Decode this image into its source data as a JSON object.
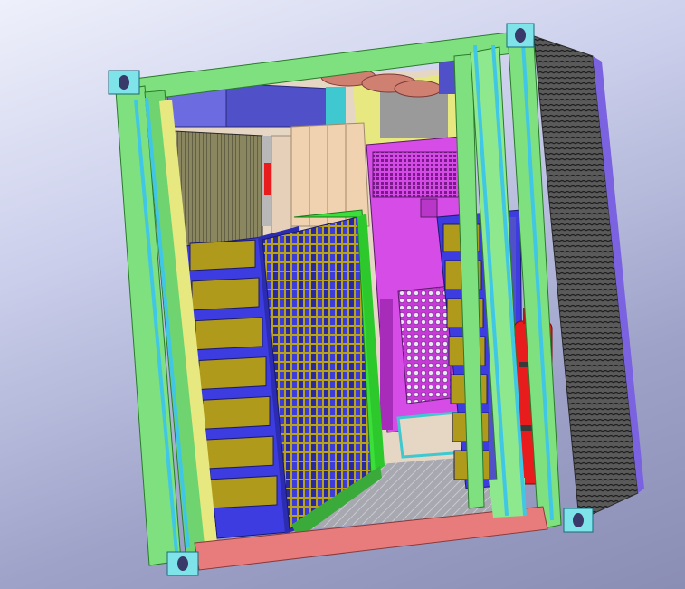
{
  "viewport": {
    "background": "gradient-blue-grey"
  },
  "model": {
    "view": "isometric-open-side",
    "colors": {
      "frame": "#7fe07f",
      "cyan_rod": "#41c7e6",
      "corner_block": "#7fe3ea",
      "floor_edge": "#e87c7c",
      "purple_panel": "#d64ce6",
      "battery_blue": "#3c3ce0",
      "battery_olive": "#b09a1c",
      "extinguisher_red": "#e81c1c",
      "ac_unit": "#3a3a3a",
      "wood_panel": "#f0d2b0",
      "yellow_wall": "#e8e880"
    },
    "components": [
      "container-frame",
      "battery-rack-left",
      "battery-rack-right",
      "open-rack-door",
      "control-cabinet",
      "fire-extinguisher",
      "air-conditioner",
      "ceiling-fans",
      "cooling-grille"
    ]
  }
}
